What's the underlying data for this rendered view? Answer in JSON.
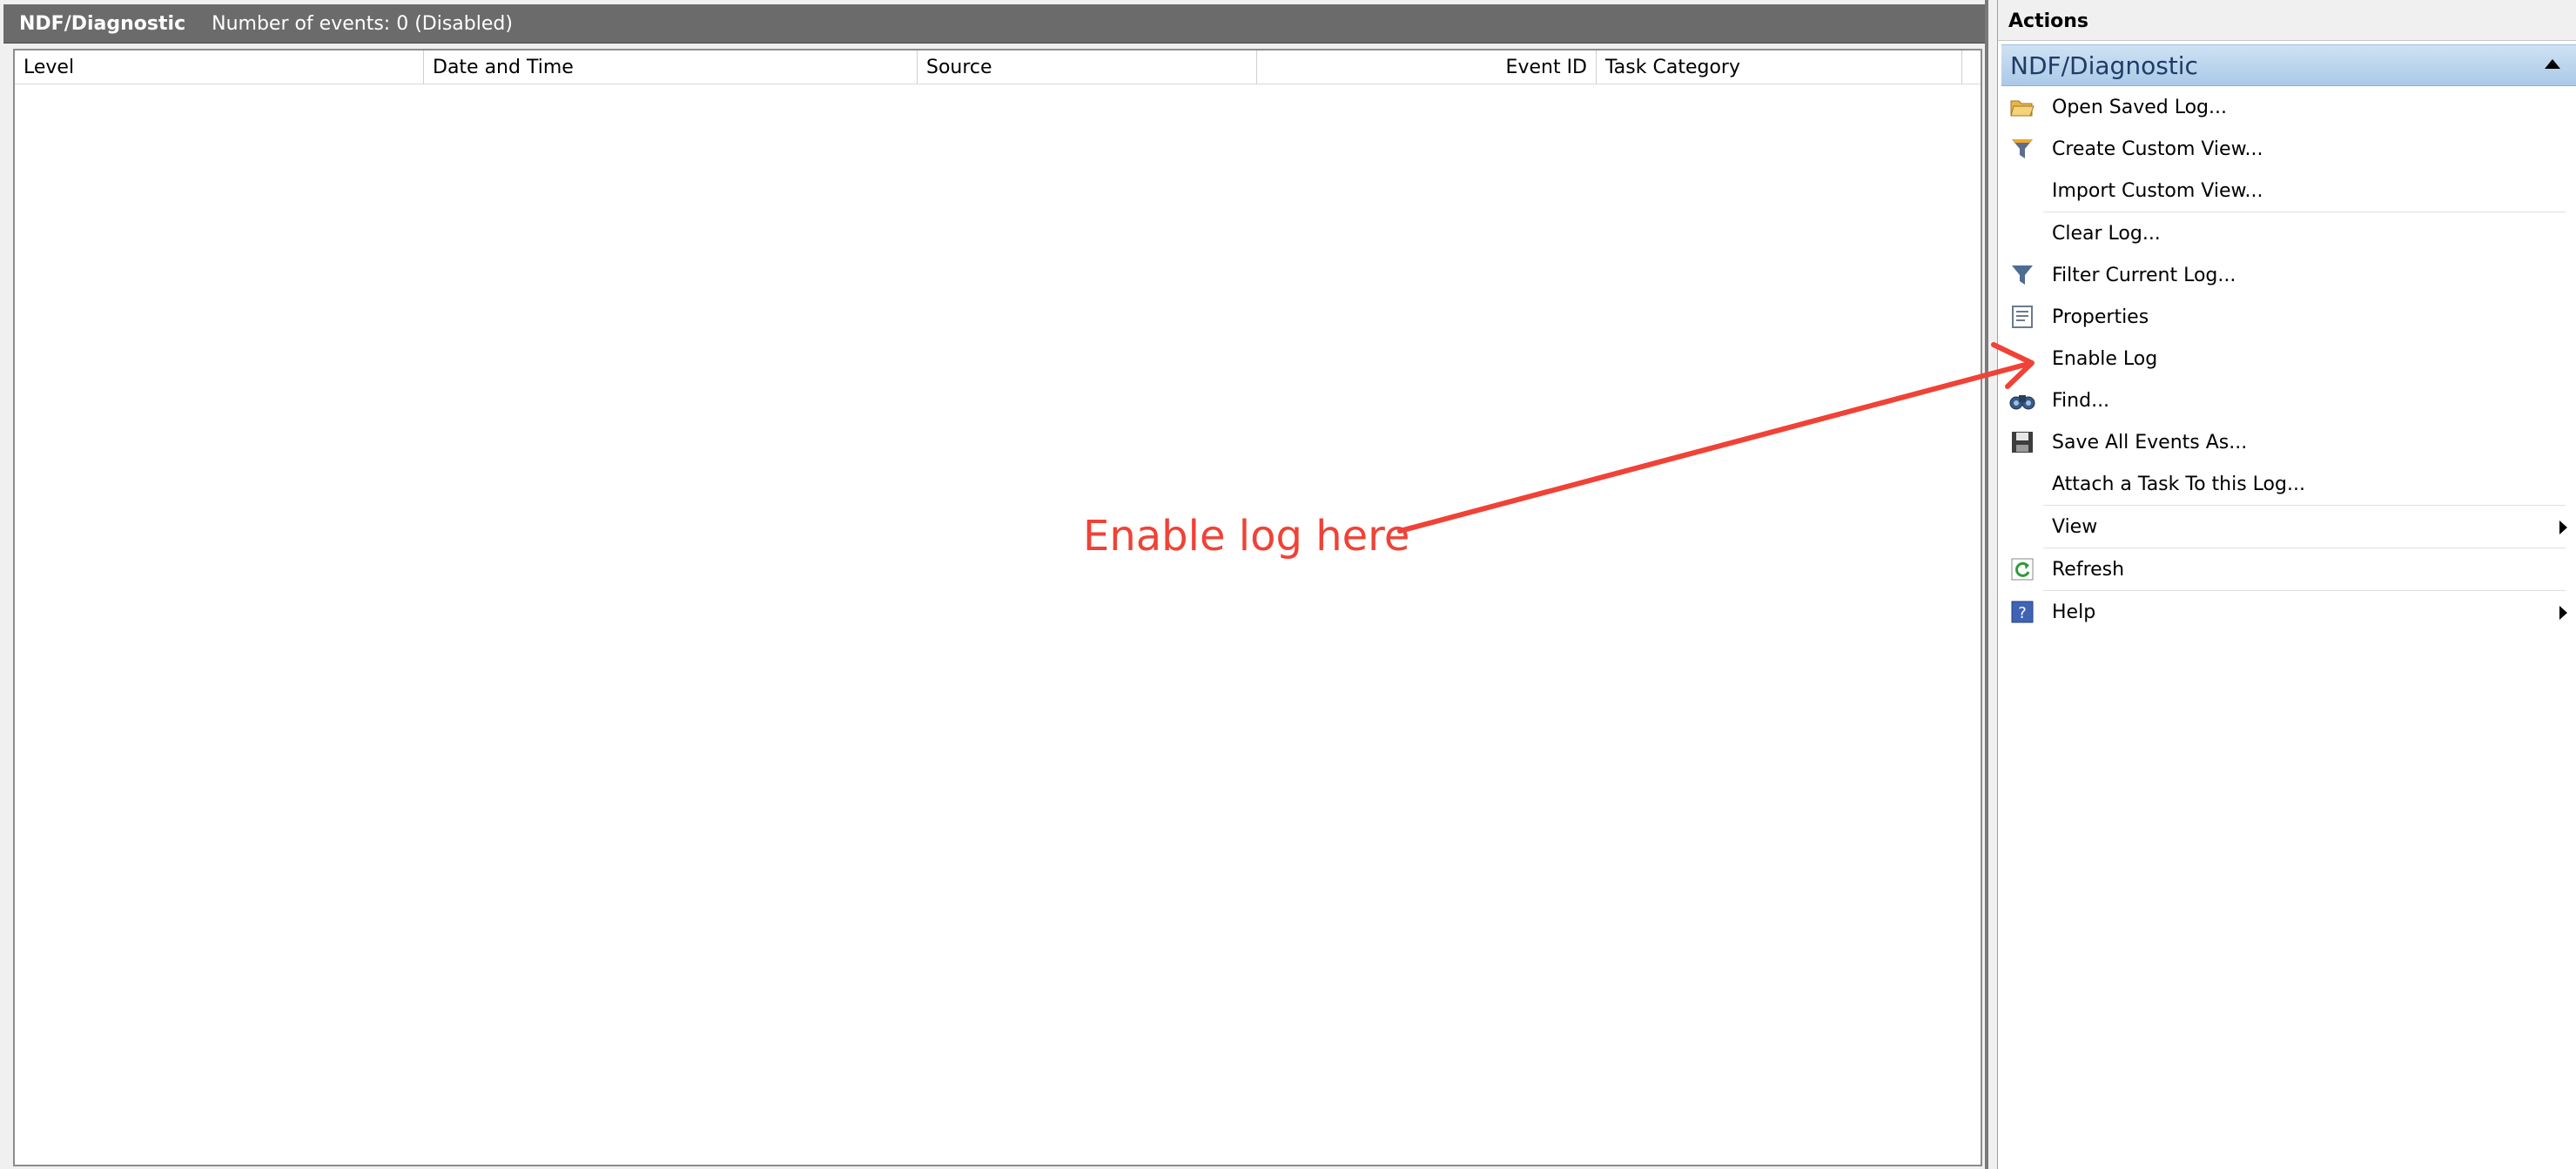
{
  "left_pane": {
    "title": "NDF/Diagnostic",
    "event_count": "Number of events: 0 (Disabled)",
    "columns": [
      "Level",
      "Date and Time",
      "Source",
      "Event ID",
      "Task Category"
    ]
  },
  "actions_pane": {
    "title": "Actions",
    "group_label": "NDF/Diagnostic",
    "items": [
      {
        "label": "Open Saved Log...",
        "icon": "open-folder-icon"
      },
      {
        "label": "Create Custom View...",
        "icon": "filter-create-icon"
      },
      {
        "label": "Import Custom View...",
        "icon": ""
      },
      {
        "label": "Clear Log...",
        "icon": ""
      },
      {
        "label": "Filter Current Log...",
        "icon": "filter-icon"
      },
      {
        "label": "Properties",
        "icon": "properties-icon"
      },
      {
        "label": "Enable Log",
        "icon": ""
      },
      {
        "label": "Find...",
        "icon": "binoculars-icon"
      },
      {
        "label": "Save All Events As...",
        "icon": "save-icon"
      },
      {
        "label": "Attach a Task To this Log...",
        "icon": ""
      },
      {
        "label": "View",
        "icon": ""
      },
      {
        "label": "Refresh",
        "icon": "refresh-icon"
      },
      {
        "label": "Help",
        "icon": "help-icon"
      }
    ]
  },
  "annotation": {
    "text": "Enable log here",
    "color": "#f04236"
  },
  "colors": {
    "header_bar": "#6b6b6b",
    "group_header": "#bcd6ef",
    "annotation_red": "#f04236"
  }
}
